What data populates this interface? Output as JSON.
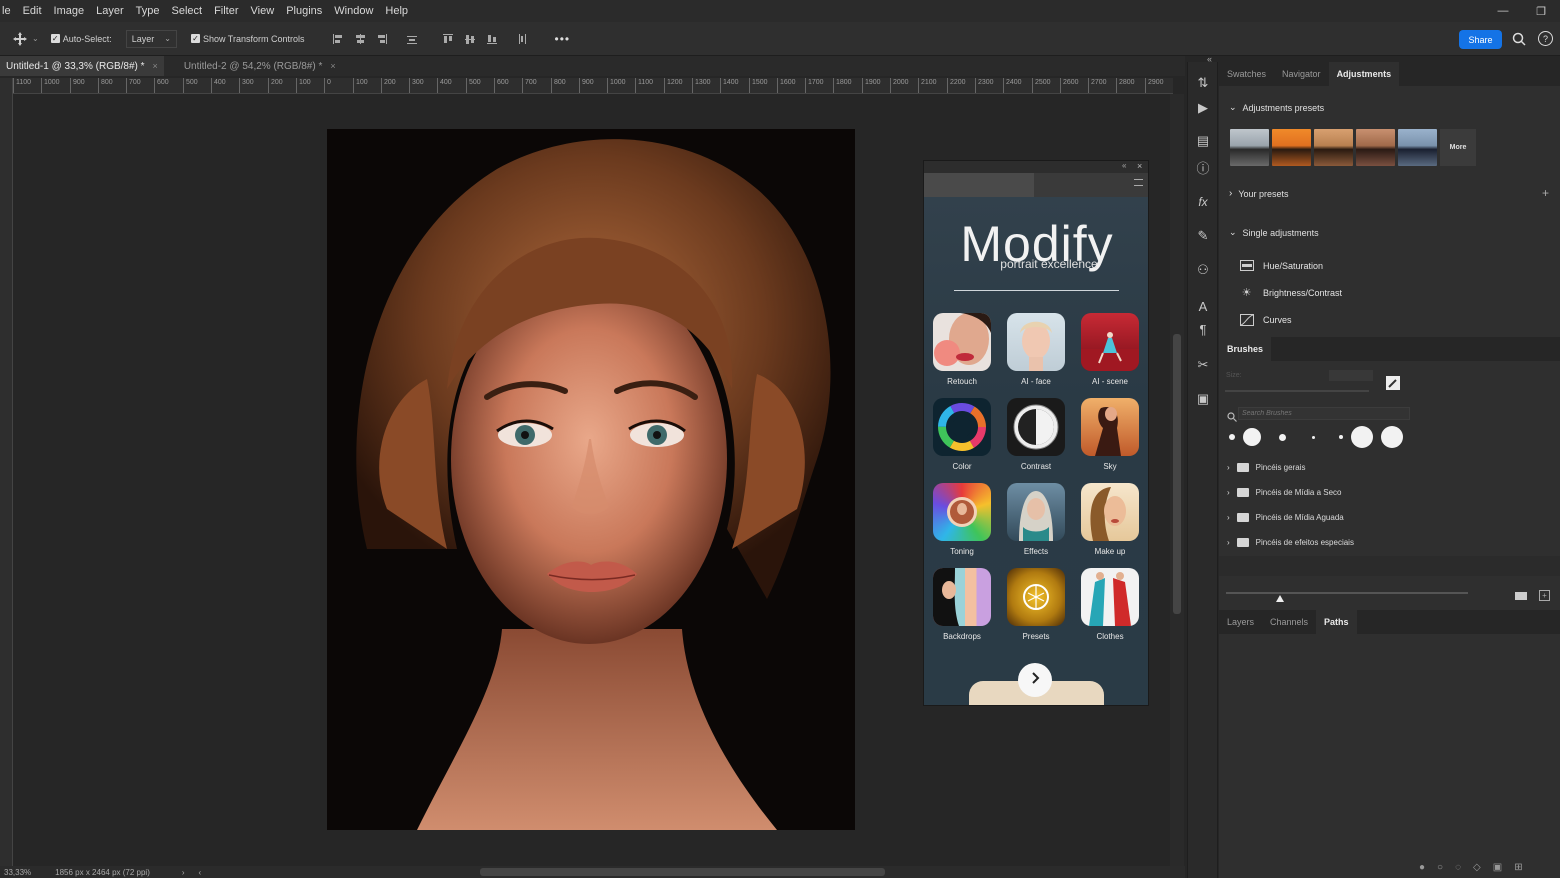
{
  "menu": [
    "le",
    "Edit",
    "Image",
    "Layer",
    "Type",
    "Select",
    "Filter",
    "View",
    "Plugins",
    "Window",
    "Help"
  ],
  "window_controls": {
    "minimize": "—",
    "restore": "❐"
  },
  "options": {
    "auto_select_label": "Auto-Select:",
    "auto_select_checked": true,
    "layer_dropdown_value": "Layer",
    "show_transform_label": "Show Transform Controls",
    "show_transform_checked": true,
    "more": "•••",
    "share_label": "Share"
  },
  "tabs": [
    {
      "label": "Untitled-1 @ 33,3% (RGB/8#) *",
      "active": true
    },
    {
      "label": "Untitled-2 @ 54,2% (RGB/8#) *",
      "active": false
    }
  ],
  "ruler_labels": [
    "1100",
    "1000",
    "900",
    "800",
    "700",
    "600",
    "500",
    "400",
    "300",
    "200",
    "100",
    "0",
    "100",
    "200",
    "300",
    "400",
    "500",
    "600",
    "700",
    "800",
    "900",
    "1000",
    "1100",
    "1200",
    "1300",
    "1400",
    "1500",
    "1600",
    "1700",
    "1800",
    "1900",
    "2000",
    "2100",
    "2200",
    "2300",
    "2400",
    "2500",
    "2600",
    "2700",
    "2800",
    "2900"
  ],
  "status": {
    "zoom": "33,33%",
    "doc_info": "1856 px x 2464 px (72 ppi)"
  },
  "plugin": {
    "title": "Modify",
    "subtitle": "portrait excellence",
    "tiles": [
      {
        "label": "Retouch",
        "icon": "retouch-icon"
      },
      {
        "label": "AI - face",
        "icon": "ai-face-icon"
      },
      {
        "label": "AI - scene",
        "icon": "ai-scene-icon"
      },
      {
        "label": "Color",
        "icon": "color-wheel-icon"
      },
      {
        "label": "Contrast",
        "icon": "contrast-icon"
      },
      {
        "label": "Sky",
        "icon": "sky-icon"
      },
      {
        "label": "Toning",
        "icon": "toning-icon"
      },
      {
        "label": "Effects",
        "icon": "effects-icon"
      },
      {
        "label": "Make up",
        "icon": "makeup-icon"
      },
      {
        "label": "Backdrops",
        "icon": "backdrops-icon"
      },
      {
        "label": "Presets",
        "icon": "presets-icon"
      },
      {
        "label": "Clothes",
        "icon": "clothes-icon"
      }
    ]
  },
  "right_tabs_top": [
    {
      "label": "Swatches",
      "active": false
    },
    {
      "label": "Navigator",
      "active": false
    },
    {
      "label": "Adjustments",
      "active": true
    }
  ],
  "adjustments": {
    "presets_title": "Adjustments presets",
    "more_label": "More",
    "your_presets": "Your presets",
    "single_title": "Single adjustments",
    "items": [
      "Hue/Saturation",
      "Brightness/Contrast",
      "Curves"
    ]
  },
  "brushes": {
    "tab": "Brushes",
    "size_label": "Size:",
    "search_placeholder": "Search Brushes",
    "folders": [
      "Pincéis gerais",
      "Pincéis de Mídia a Seco",
      "Pincéis de Mídia Aguada",
      "Pincéis de efeitos especiais"
    ]
  },
  "right_tabs_bottom": [
    {
      "label": "Layers",
      "active": false
    },
    {
      "label": "Channels",
      "active": false
    },
    {
      "label": "Paths",
      "active": true
    }
  ],
  "colors": {
    "accent": "#1473e6",
    "panel_bg": "#2f2f2f",
    "plugin_bg": "#2c3a44"
  }
}
